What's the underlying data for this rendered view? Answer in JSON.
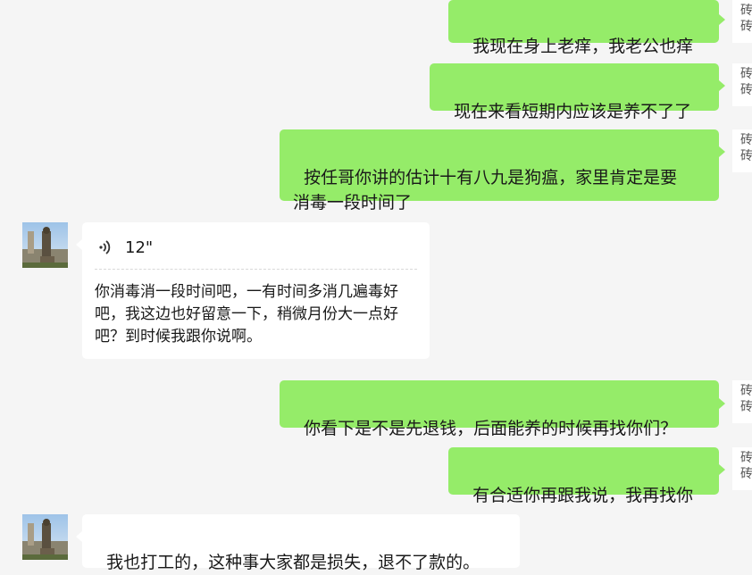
{
  "messages": [
    {
      "side": "self",
      "text": "我现在身上老痒，我老公也痒"
    },
    {
      "side": "self",
      "text": "现在来看短期内应该是养不了了"
    },
    {
      "side": "self",
      "text": "按任哥你讲的估计十有八九是狗瘟，家里肯定是要\n消毒一段时间了"
    },
    {
      "side": "other",
      "type": "voice",
      "duration": "12\"",
      "transcript": "你消毒消一段时间吧，一有时间多消几遍毒好\n吧，我这边也好留意一下，稍微月份大一点好\n吧？到时候我跟你说啊。"
    },
    {
      "side": "self",
      "text": "你看下是不是先退钱，后面能养的时候再找你们？"
    },
    {
      "side": "self",
      "text": "有合适你再跟我说，我再找你"
    },
    {
      "side": "other",
      "text": "我也打工的，这种事大家都是损失，退不了款的。"
    }
  ],
  "self_avatar_text": "砖\n砖",
  "colors": {
    "self_bubble": "#95ec69",
    "other_bubble": "#ffffff",
    "background": "#f5f5f5"
  },
  "icons": {
    "voice": "voice-wave-icon"
  }
}
